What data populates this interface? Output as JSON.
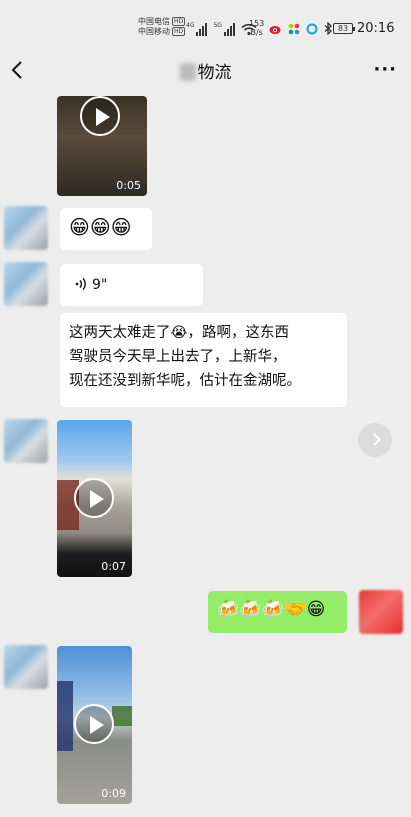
{
  "status_bar": {
    "carrier1": "中国电信",
    "carrier2": "中国移动",
    "hd": "HD",
    "net1": "4G",
    "net2": "5G",
    "speed_value": "153",
    "speed_unit": "B/s",
    "battery": "83",
    "time": "20:16"
  },
  "navbar": {
    "back_icon": "chevron-left-icon",
    "title": "物流",
    "more_label": "···"
  },
  "messages": [
    {
      "type": "video",
      "side": "left",
      "duration": "0:05"
    },
    {
      "type": "emoji",
      "side": "left",
      "content": "😁😁😁"
    },
    {
      "type": "voice",
      "side": "left",
      "duration": "9\""
    },
    {
      "type": "text",
      "side": "left",
      "line1": "这两天太难走了😭，路啊，这东西",
      "line2": "驾驶员今天早上出去了，上新华，",
      "line3": "现在还没到新华呢，估计在金湖呢。"
    },
    {
      "type": "video",
      "side": "left",
      "duration": "0:07"
    },
    {
      "type": "emoji",
      "side": "right",
      "content": "🍻🍻🍻🤝😁"
    },
    {
      "type": "video",
      "side": "left",
      "duration": "0:09"
    }
  ],
  "colors": {
    "background": "#ededed",
    "my_bubble": "#95ec69",
    "other_bubble": "#ffffff"
  }
}
